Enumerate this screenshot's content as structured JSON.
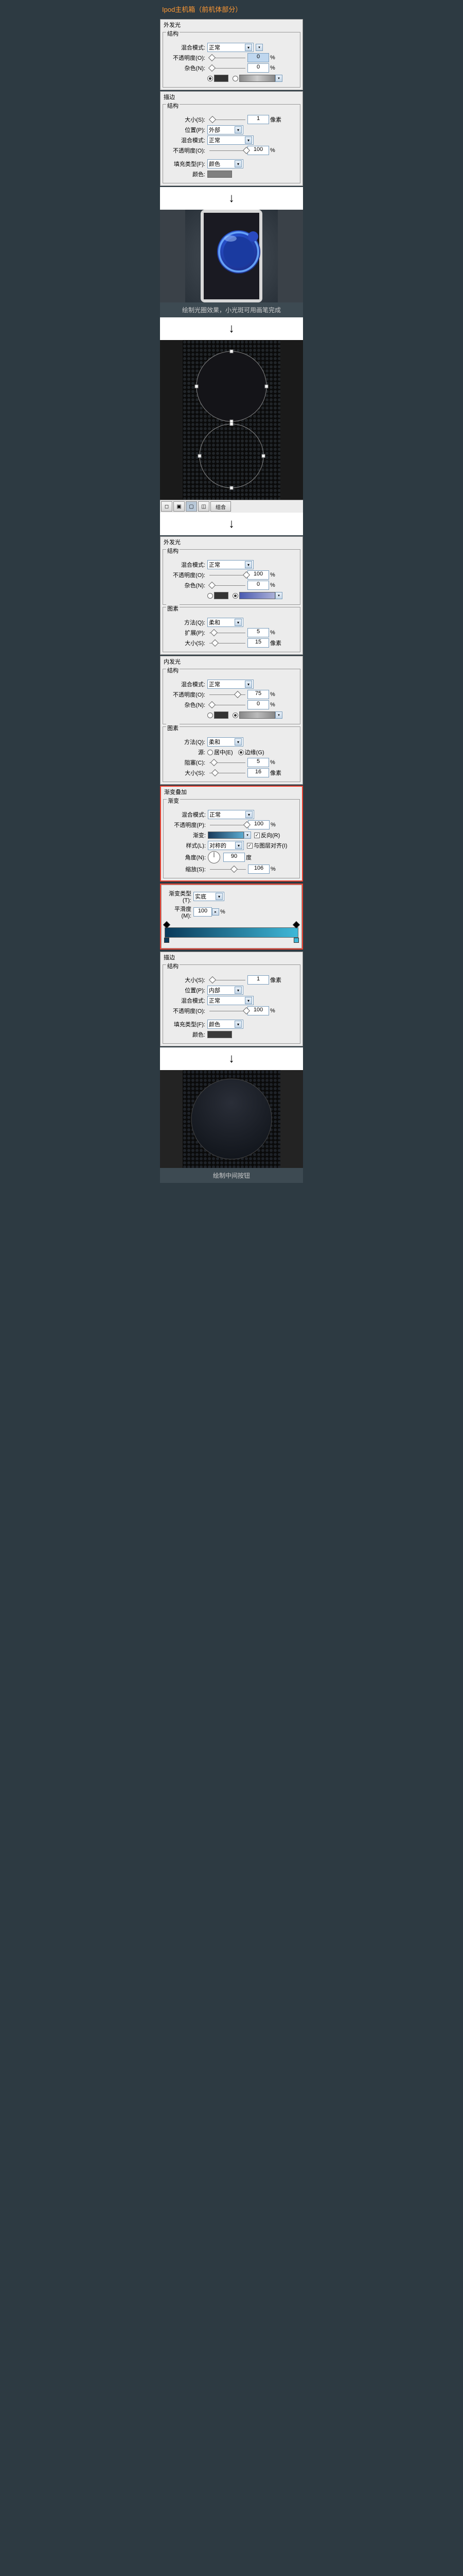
{
  "title": "Ipod主机箱（前机体部分）",
  "outer_glow_1": {
    "title": "外发光",
    "structure_label": "结构",
    "blend_label": "混合模式:",
    "blend_value": "正常",
    "opacity_label": "不透明度(O):",
    "opacity_value": "0",
    "noise_label": "杂色(N):",
    "noise_value": "0"
  },
  "stroke_1": {
    "title": "描边",
    "structure_label": "结构",
    "size_label": "大小(S):",
    "size_value": "1",
    "size_unit": "像素",
    "position_label": "位置(P):",
    "position_value": "外部",
    "blend_label": "混合模式:",
    "blend_value": "正常",
    "opacity_label": "不透明度(O):",
    "opacity_value": "100",
    "filltype_label": "填充类型(F):",
    "filltype_value": "颜色",
    "color_label": "颜色:"
  },
  "caption_1": "绘制光圈效果，小光斑可用画笔完成",
  "radio_btn": "圆角",
  "toolbar_path_combine": "组合",
  "outer_glow_2": {
    "title": "外发光",
    "structure_label": "结构",
    "blend_label": "混合模式:",
    "blend_value": "正常",
    "opacity_label": "不透明度(O):",
    "opacity_value": "100",
    "noise_label": "杂色(N):",
    "noise_value": "0",
    "elements_label": "图素",
    "method_label": "方法(Q):",
    "method_value": "柔和",
    "spread_label": "扩展(P):",
    "spread_value": "5",
    "size_label": "大小(S):",
    "size_value": "15",
    "size_unit": "像素"
  },
  "inner_glow": {
    "title": "内发光",
    "structure_label": "结构",
    "blend_label": "混合模式:",
    "blend_value": "正常",
    "opacity_label": "不透明度(O):",
    "opacity_value": "75",
    "noise_label": "杂色(N):",
    "noise_value": "0",
    "elements_label": "图素",
    "method_label": "方法(Q):",
    "method_value": "柔和",
    "source_label": "源:",
    "source_center": "居中(E)",
    "source_edge": "边缘(G)",
    "choke_label": "阻塞(C):",
    "choke_value": "5",
    "size_label": "大小(S):",
    "size_value": "16",
    "size_unit": "像素"
  },
  "gradient_overlay": {
    "title": "渐变叠加",
    "gradient_label": "渐变",
    "blend_label": "混合模式:",
    "blend_value": "正常",
    "opacity_label": "不透明度(P):",
    "opacity_value": "100",
    "gradient_field_label": "渐变:",
    "reverse_label": "反向(R)",
    "style_label": "样式(L):",
    "style_value": "对称的",
    "align_label": "与图层对齐(I)",
    "angle_label": "角度(N):",
    "angle_value": "90",
    "angle_unit": "度",
    "scale_label": "缩放(S):",
    "scale_value": "106"
  },
  "grad_editor": {
    "type_label": "渐变类型(T):",
    "type_value": "实底",
    "smooth_label": "平滑度(M):",
    "smooth_value": "100"
  },
  "stroke_2": {
    "title": "描边",
    "structure_label": "结构",
    "size_label": "大小(S):",
    "size_value": "1",
    "size_unit": "像素",
    "position_label": "位置(P):",
    "position_value": "内部",
    "blend_label": "混合模式:",
    "blend_value": "正常",
    "opacity_label": "不透明度(O):",
    "opacity_value": "100",
    "filltype_label": "填充类型(F):",
    "filltype_value": "颜色",
    "color_label": "颜色:"
  },
  "caption_2": "绘制中间按钮",
  "pct": "%"
}
